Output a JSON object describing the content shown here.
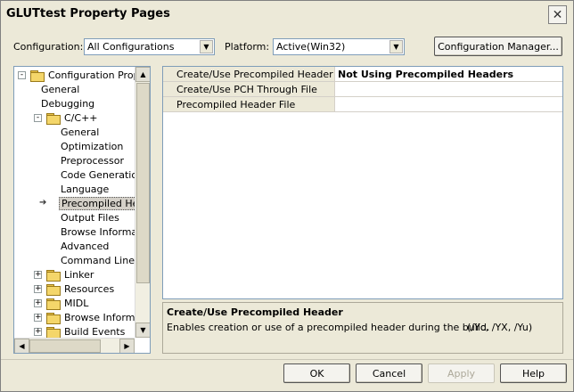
{
  "window": {
    "title": "GLUTtest Property Pages",
    "close_glyph": "✕"
  },
  "header": {
    "configuration_label": "Configuration:",
    "configuration_value": "All Configurations",
    "platform_label": "Platform:",
    "platform_value": "Active(Win32)",
    "configuration_manager_button": "Configuration Manager..."
  },
  "tree": {
    "items": [
      {
        "label": "Configuration Properties",
        "indent": 0,
        "icon": "folder-open-icon",
        "toggle": "-",
        "selected": false
      },
      {
        "label": "General",
        "indent": 1,
        "icon": "",
        "toggle": "",
        "selected": false
      },
      {
        "label": "Debugging",
        "indent": 1,
        "icon": "",
        "toggle": "",
        "selected": false
      },
      {
        "label": "C/C++",
        "indent": 1,
        "icon": "folder-open-icon",
        "toggle": "-",
        "selected": false
      },
      {
        "label": "General",
        "indent": 2,
        "icon": "",
        "toggle": "",
        "selected": false
      },
      {
        "label": "Optimization",
        "indent": 2,
        "icon": "",
        "toggle": "",
        "selected": false
      },
      {
        "label": "Preprocessor",
        "indent": 2,
        "icon": "",
        "toggle": "",
        "selected": false
      },
      {
        "label": "Code Generation",
        "indent": 2,
        "icon": "",
        "toggle": "",
        "selected": false
      },
      {
        "label": "Language",
        "indent": 2,
        "icon": "",
        "toggle": "",
        "selected": false
      },
      {
        "label": "Precompiled Headers",
        "indent": 2,
        "icon": "arrow-pointer-icon",
        "toggle": "",
        "selected": true
      },
      {
        "label": "Output Files",
        "indent": 2,
        "icon": "",
        "toggle": "",
        "selected": false
      },
      {
        "label": "Browse Information",
        "indent": 2,
        "icon": "",
        "toggle": "",
        "selected": false
      },
      {
        "label": "Advanced",
        "indent": 2,
        "icon": "",
        "toggle": "",
        "selected": false
      },
      {
        "label": "Command Line",
        "indent": 2,
        "icon": "",
        "toggle": "",
        "selected": false
      },
      {
        "label": "Linker",
        "indent": 1,
        "icon": "folder-icon",
        "toggle": "+",
        "selected": false
      },
      {
        "label": "Resources",
        "indent": 1,
        "icon": "folder-icon",
        "toggle": "+",
        "selected": false
      },
      {
        "label": "MIDL",
        "indent": 1,
        "icon": "folder-icon",
        "toggle": "+",
        "selected": false
      },
      {
        "label": "Browse Information",
        "indent": 1,
        "icon": "folder-icon",
        "toggle": "+",
        "selected": false
      },
      {
        "label": "Build Events",
        "indent": 1,
        "icon": "folder-icon",
        "toggle": "+",
        "selected": false
      }
    ]
  },
  "properties": {
    "rows": [
      {
        "name": "Create/Use Precompiled Header",
        "value": "Not Using Precompiled Headers",
        "bold": true
      },
      {
        "name": "Create/Use PCH Through File",
        "value": "",
        "bold": false
      },
      {
        "name": "Precompiled Header File",
        "value": "",
        "bold": false
      }
    ]
  },
  "description": {
    "title": "Create/Use Precompiled Header",
    "body": "Enables creation or use of a precompiled header during the build.",
    "switches": "(/Yc, /YX, /Yu)"
  },
  "buttons": {
    "ok": "OK",
    "cancel": "Cancel",
    "apply": "Apply",
    "help": "Help"
  },
  "colors": {
    "dialog_bg": "#ece9d8",
    "field_border": "#7f9db9"
  }
}
